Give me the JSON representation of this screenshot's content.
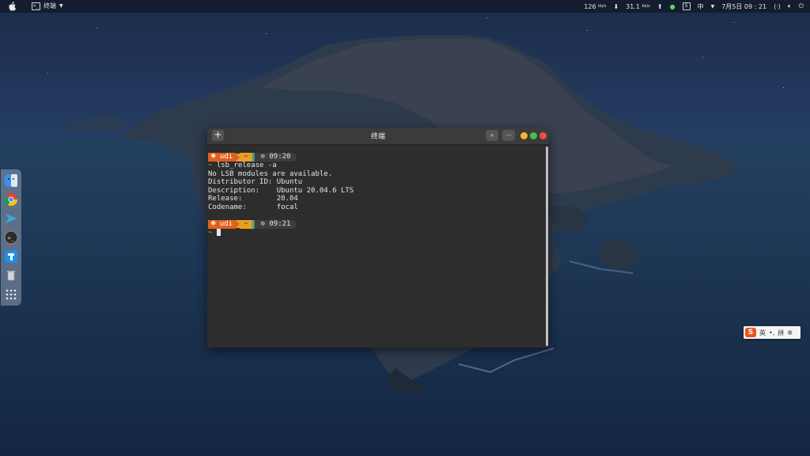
{
  "topbar": {
    "app_name": "终端",
    "net_down": "126",
    "net_down_unit": "kb/s",
    "net_up": "31.1",
    "net_up_unit": "kb/s",
    "ime_label": "中",
    "datetime": "7月5日 09 : 21",
    "sogou_icon_label": "S"
  },
  "terminal": {
    "title": "终端",
    "new_tab_label": "+",
    "search_label": "⌕",
    "menu_label": "···",
    "prompt1": {
      "user": "udi",
      "path": "~",
      "time": "09:20"
    },
    "command1": "lsb_release -a",
    "output": [
      "No LSB modules are available.",
      "Distributor ID: Ubuntu",
      "Description:    Ubuntu 20.04.6 LTS",
      "Release:        20.04",
      "Codename:       focal"
    ],
    "prompt2": {
      "user": "udi",
      "path": "~",
      "time": "09:21"
    },
    "input_arrow": "~",
    "user_glyph": "☻",
    "clock_glyph": "⊙"
  },
  "ime_widget": {
    "logo": "S",
    "mode": "英",
    "punct": "•,",
    "pinyin": "拼",
    "settings": "✲"
  },
  "colors": {
    "prompt_user": "#e0601f",
    "prompt_path": "#e8a023",
    "terminal_bg": "#2d2d2d"
  }
}
